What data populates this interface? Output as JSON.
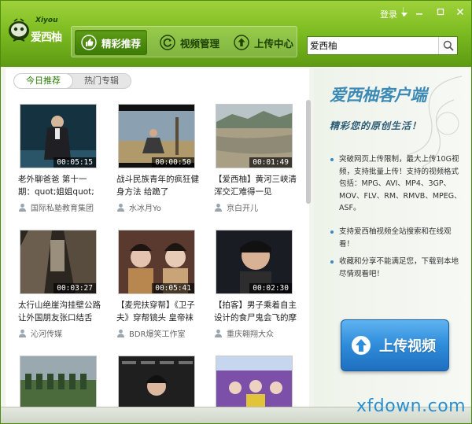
{
  "app": {
    "logo_small": "Xiyou",
    "logo_text": "爱西柚",
    "login_label": "登录",
    "colors": {
      "header_green": "#7ebd22",
      "accent_blue": "#2f8ddb",
      "title_blue": "#3c8ab5"
    }
  },
  "nav": {
    "items": [
      {
        "label": "精彩推荐",
        "icon": "thumbs-up-icon"
      },
      {
        "label": "视频管理",
        "icon": "refresh-icon"
      },
      {
        "label": "上传中心",
        "icon": "upload-arrow-icon"
      }
    ]
  },
  "search": {
    "value": "爱西柚",
    "icon": "search-icon"
  },
  "tabs": [
    {
      "label": "今日推荐"
    },
    {
      "label": "热门专辑"
    }
  ],
  "videos": [
    {
      "duration": "00:05:15",
      "title": "老外聊爸爸 第十一期：quot;姐姐quot;大危机",
      "user": "国际私塾教育集团",
      "thumb": "presenter"
    },
    {
      "duration": "00:00:50",
      "title": "战斗民族青年的疯狂健身方法 给跪了",
      "user": "水冰月Yo",
      "thumb": "outdoor"
    },
    {
      "duration": "00:01:49",
      "title": "【爱西柚】黄河三峡清浑交汇难得一见",
      "user": "京白开儿",
      "thumb": "river"
    },
    {
      "duration": "00:03:27",
      "title": "太行山绝崖沟挂壁公路让外国朋友张口结舌",
      "user": "沁河传媒",
      "thumb": "tunnel"
    },
    {
      "duration": "00:05:41",
      "title": "【麦兜扶穿帮】《卫子夫》穿帮镜头 皇帝袜子",
      "user": "BDR爆笑工作室",
      "thumb": "drama"
    },
    {
      "duration": "00:02:30",
      "title": "【拍客】男子乘着自主设计的食尸鬼会飞的摩",
      "user": "重庆翱翔大众",
      "thumb": "interview"
    },
    {
      "duration": "",
      "title": "",
      "user": "",
      "thumb": "parade"
    },
    {
      "duration": "",
      "title": "",
      "user": "",
      "thumb": "bvlgari"
    },
    {
      "duration": "",
      "title": "",
      "user": "",
      "thumb": "stage"
    }
  ],
  "promo": {
    "title": "爱西柚客户端",
    "subtitle": "精彩您的原创生活！",
    "features": [
      "突破网页上传限制，最大上传10G视频，支持批量上传！支持的视频格式包括：MPG、AVI、MP4、3GP、MOV、FLV、RM、RMVB、MPEG、ASF。",
      "支持爱西柚视频全站搜索和在线观看！",
      "收藏和分享不能满足您，下载到本地尽情观看吧！"
    ],
    "upload_label": "上传视频"
  },
  "watermark": "xfdown.com"
}
